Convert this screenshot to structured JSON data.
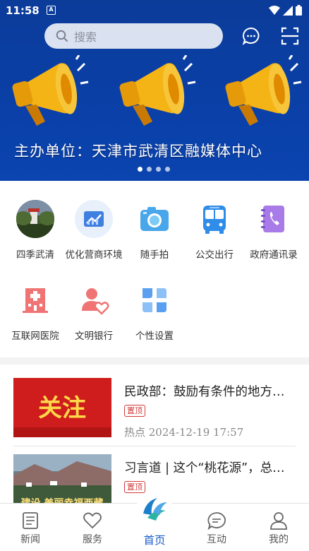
{
  "status_bar": {
    "time": "11:58",
    "notice_glyph": "A"
  },
  "header": {
    "search_placeholder": "搜索",
    "message_icon": "message-icon",
    "scan_icon": "scan-icon"
  },
  "banner": {
    "caption": "主办单位：天津市武清区融媒体中心",
    "slide_count": 4,
    "active_slide": 0
  },
  "quick_links": [
    {
      "label": "四季武清",
      "icon": "photo-thumb"
    },
    {
      "label": "优化营商环境",
      "icon": "chart-icon"
    },
    {
      "label": "随手拍",
      "icon": "camera-icon"
    },
    {
      "label": "公交出行",
      "icon": "bus-icon"
    },
    {
      "label": "政府通讯录",
      "icon": "phonebook-icon"
    },
    {
      "label": "互联网医院",
      "icon": "hospital-icon"
    },
    {
      "label": "文明银行",
      "icon": "user-heart-icon"
    },
    {
      "label": "个性设置",
      "icon": "grid-icon"
    }
  ],
  "news": [
    {
      "thumb_text": "关注",
      "title": "民政部：鼓励有条件的地方探索",
      "tag": "置顶",
      "meta": "热点  2024-12-19 17:57"
    },
    {
      "thumb_text": "建设 美丽幸福西藏",
      "title": "习言道 | 这个“桃花源”，总书记",
      "tag": "置顶",
      "meta": ""
    }
  ],
  "tabbar": [
    {
      "label": "新闻",
      "icon": "news-icon"
    },
    {
      "label": "服务",
      "icon": "heart-icon"
    },
    {
      "label": "首页",
      "icon": "home-logo-icon"
    },
    {
      "label": "互动",
      "icon": "chat-icon"
    },
    {
      "label": "我的",
      "icon": "user-icon"
    }
  ],
  "colors": {
    "banner": "#0b3c9a",
    "accent": "#1d5fd0",
    "tag": "#d23a3a"
  }
}
